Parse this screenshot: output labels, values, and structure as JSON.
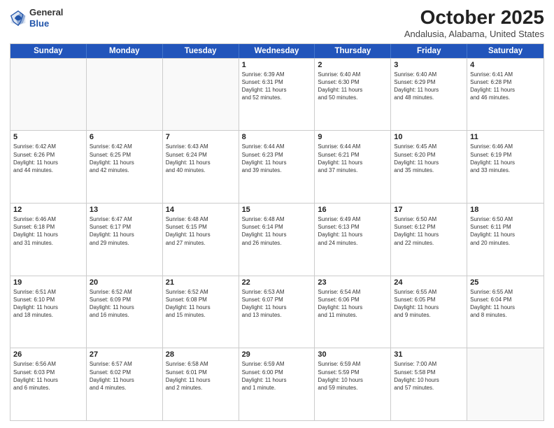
{
  "header": {
    "logo_general": "General",
    "logo_blue": "Blue",
    "month_title": "October 2025",
    "location": "Andalusia, Alabama, United States"
  },
  "days_of_week": [
    "Sunday",
    "Monday",
    "Tuesday",
    "Wednesday",
    "Thursday",
    "Friday",
    "Saturday"
  ],
  "weeks": [
    [
      {
        "day": "",
        "lines": []
      },
      {
        "day": "",
        "lines": []
      },
      {
        "day": "",
        "lines": []
      },
      {
        "day": "1",
        "lines": [
          "Sunrise: 6:39 AM",
          "Sunset: 6:31 PM",
          "Daylight: 11 hours",
          "and 52 minutes."
        ]
      },
      {
        "day": "2",
        "lines": [
          "Sunrise: 6:40 AM",
          "Sunset: 6:30 PM",
          "Daylight: 11 hours",
          "and 50 minutes."
        ]
      },
      {
        "day": "3",
        "lines": [
          "Sunrise: 6:40 AM",
          "Sunset: 6:29 PM",
          "Daylight: 11 hours",
          "and 48 minutes."
        ]
      },
      {
        "day": "4",
        "lines": [
          "Sunrise: 6:41 AM",
          "Sunset: 6:28 PM",
          "Daylight: 11 hours",
          "and 46 minutes."
        ]
      }
    ],
    [
      {
        "day": "5",
        "lines": [
          "Sunrise: 6:42 AM",
          "Sunset: 6:26 PM",
          "Daylight: 11 hours",
          "and 44 minutes."
        ]
      },
      {
        "day": "6",
        "lines": [
          "Sunrise: 6:42 AM",
          "Sunset: 6:25 PM",
          "Daylight: 11 hours",
          "and 42 minutes."
        ]
      },
      {
        "day": "7",
        "lines": [
          "Sunrise: 6:43 AM",
          "Sunset: 6:24 PM",
          "Daylight: 11 hours",
          "and 40 minutes."
        ]
      },
      {
        "day": "8",
        "lines": [
          "Sunrise: 6:44 AM",
          "Sunset: 6:23 PM",
          "Daylight: 11 hours",
          "and 39 minutes."
        ]
      },
      {
        "day": "9",
        "lines": [
          "Sunrise: 6:44 AM",
          "Sunset: 6:21 PM",
          "Daylight: 11 hours",
          "and 37 minutes."
        ]
      },
      {
        "day": "10",
        "lines": [
          "Sunrise: 6:45 AM",
          "Sunset: 6:20 PM",
          "Daylight: 11 hours",
          "and 35 minutes."
        ]
      },
      {
        "day": "11",
        "lines": [
          "Sunrise: 6:46 AM",
          "Sunset: 6:19 PM",
          "Daylight: 11 hours",
          "and 33 minutes."
        ]
      }
    ],
    [
      {
        "day": "12",
        "lines": [
          "Sunrise: 6:46 AM",
          "Sunset: 6:18 PM",
          "Daylight: 11 hours",
          "and 31 minutes."
        ]
      },
      {
        "day": "13",
        "lines": [
          "Sunrise: 6:47 AM",
          "Sunset: 6:17 PM",
          "Daylight: 11 hours",
          "and 29 minutes."
        ]
      },
      {
        "day": "14",
        "lines": [
          "Sunrise: 6:48 AM",
          "Sunset: 6:15 PM",
          "Daylight: 11 hours",
          "and 27 minutes."
        ]
      },
      {
        "day": "15",
        "lines": [
          "Sunrise: 6:48 AM",
          "Sunset: 6:14 PM",
          "Daylight: 11 hours",
          "and 26 minutes."
        ]
      },
      {
        "day": "16",
        "lines": [
          "Sunrise: 6:49 AM",
          "Sunset: 6:13 PM",
          "Daylight: 11 hours",
          "and 24 minutes."
        ]
      },
      {
        "day": "17",
        "lines": [
          "Sunrise: 6:50 AM",
          "Sunset: 6:12 PM",
          "Daylight: 11 hours",
          "and 22 minutes."
        ]
      },
      {
        "day": "18",
        "lines": [
          "Sunrise: 6:50 AM",
          "Sunset: 6:11 PM",
          "Daylight: 11 hours",
          "and 20 minutes."
        ]
      }
    ],
    [
      {
        "day": "19",
        "lines": [
          "Sunrise: 6:51 AM",
          "Sunset: 6:10 PM",
          "Daylight: 11 hours",
          "and 18 minutes."
        ]
      },
      {
        "day": "20",
        "lines": [
          "Sunrise: 6:52 AM",
          "Sunset: 6:09 PM",
          "Daylight: 11 hours",
          "and 16 minutes."
        ]
      },
      {
        "day": "21",
        "lines": [
          "Sunrise: 6:52 AM",
          "Sunset: 6:08 PM",
          "Daylight: 11 hours",
          "and 15 minutes."
        ]
      },
      {
        "day": "22",
        "lines": [
          "Sunrise: 6:53 AM",
          "Sunset: 6:07 PM",
          "Daylight: 11 hours",
          "and 13 minutes."
        ]
      },
      {
        "day": "23",
        "lines": [
          "Sunrise: 6:54 AM",
          "Sunset: 6:06 PM",
          "Daylight: 11 hours",
          "and 11 minutes."
        ]
      },
      {
        "day": "24",
        "lines": [
          "Sunrise: 6:55 AM",
          "Sunset: 6:05 PM",
          "Daylight: 11 hours",
          "and 9 minutes."
        ]
      },
      {
        "day": "25",
        "lines": [
          "Sunrise: 6:55 AM",
          "Sunset: 6:04 PM",
          "Daylight: 11 hours",
          "and 8 minutes."
        ]
      }
    ],
    [
      {
        "day": "26",
        "lines": [
          "Sunrise: 6:56 AM",
          "Sunset: 6:03 PM",
          "Daylight: 11 hours",
          "and 6 minutes."
        ]
      },
      {
        "day": "27",
        "lines": [
          "Sunrise: 6:57 AM",
          "Sunset: 6:02 PM",
          "Daylight: 11 hours",
          "and 4 minutes."
        ]
      },
      {
        "day": "28",
        "lines": [
          "Sunrise: 6:58 AM",
          "Sunset: 6:01 PM",
          "Daylight: 11 hours",
          "and 2 minutes."
        ]
      },
      {
        "day": "29",
        "lines": [
          "Sunrise: 6:59 AM",
          "Sunset: 6:00 PM",
          "Daylight: 11 hours",
          "and 1 minute."
        ]
      },
      {
        "day": "30",
        "lines": [
          "Sunrise: 6:59 AM",
          "Sunset: 5:59 PM",
          "Daylight: 10 hours",
          "and 59 minutes."
        ]
      },
      {
        "day": "31",
        "lines": [
          "Sunrise: 7:00 AM",
          "Sunset: 5:58 PM",
          "Daylight: 10 hours",
          "and 57 minutes."
        ]
      },
      {
        "day": "",
        "lines": []
      }
    ]
  ]
}
